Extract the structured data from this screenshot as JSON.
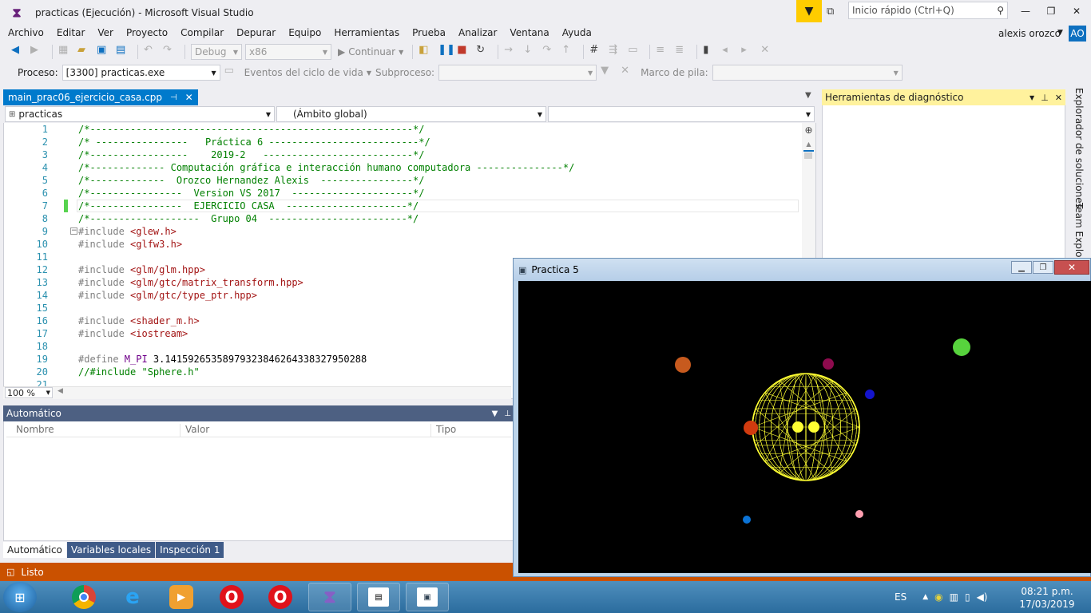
{
  "window": {
    "title": "practicas (Ejecución) - Microsoft Visual Studio",
    "quick_launch_placeholder": "Inicio rápido (Ctrl+Q)",
    "controls": {
      "minimize": "—",
      "maximize": "❐",
      "close": "✕"
    }
  },
  "menu": [
    "Archivo",
    "Editar",
    "Ver",
    "Proyecto",
    "Compilar",
    "Depurar",
    "Equipo",
    "Herramientas",
    "Prueba",
    "Analizar",
    "Ventana",
    "Ayuda"
  ],
  "user": {
    "name": "alexis orozco",
    "initials": "AO",
    "avatar_color": "#0e70c0"
  },
  "toolbar": {
    "config": "Debug",
    "platform": "x86",
    "continue_label": "Continuar"
  },
  "debug_bar": {
    "process_label": "Proceso:",
    "process_value": "[3300] practicas.exe",
    "lifecycle_label": "Eventos del ciclo de vida",
    "thread_label": "Subproceso:",
    "stack_label": "Marco de pila:"
  },
  "editor": {
    "tab_name": "main_prac06_ejercicio_casa.cpp",
    "scope_project": "practicas",
    "scope_global": "(Ámbito global)",
    "zoom": "100 %",
    "lines": [
      {
        "n": "1",
        "parts": [
          {
            "c": "cm",
            "t": "/*--------------------------------------------------------*/"
          }
        ]
      },
      {
        "n": "2",
        "parts": [
          {
            "c": "cm",
            "t": "/* ----------------   Práctica 6 --------------------------*/"
          }
        ]
      },
      {
        "n": "3",
        "parts": [
          {
            "c": "cm",
            "t": "/*-----------------    2019-2   --------------------------*/"
          }
        ]
      },
      {
        "n": "4",
        "parts": [
          {
            "c": "cm",
            "t": "/*------------- Computación gráfica e interacción humano computadora ---------------*/"
          }
        ]
      },
      {
        "n": "5",
        "parts": [
          {
            "c": "cm",
            "t": "/*-------------  Orozco Hernandez Alexis  ----------------*/"
          }
        ]
      },
      {
        "n": "6",
        "parts": [
          {
            "c": "cm",
            "t": "/*----------------  Version VS 2017  ---------------------*/"
          }
        ]
      },
      {
        "n": "7",
        "parts": [
          {
            "c": "cm",
            "t": "/*----------------  EJERCICIO CASA  ---------------------*/"
          }
        ]
      },
      {
        "n": "8",
        "parts": [
          {
            "c": "cm",
            "t": "/*-------------------  Grupo 04  ------------------------*/"
          }
        ]
      },
      {
        "n": "9",
        "parts": [
          {
            "c": "kw",
            "t": "#include "
          },
          {
            "c": "str",
            "t": "<glew.h>"
          }
        ]
      },
      {
        "n": "10",
        "parts": [
          {
            "c": "kw",
            "t": "#include "
          },
          {
            "c": "str",
            "t": "<glfw3.h>"
          }
        ]
      },
      {
        "n": "11",
        "parts": []
      },
      {
        "n": "12",
        "parts": [
          {
            "c": "kw",
            "t": "#include "
          },
          {
            "c": "str",
            "t": "<glm/glm.hpp>"
          }
        ]
      },
      {
        "n": "13",
        "parts": [
          {
            "c": "kw",
            "t": "#include "
          },
          {
            "c": "str",
            "t": "<glm/gtc/matrix_transform.hpp>"
          }
        ]
      },
      {
        "n": "14",
        "parts": [
          {
            "c": "kw",
            "t": "#include "
          },
          {
            "c": "str",
            "t": "<glm/gtc/type_ptr.hpp>"
          }
        ]
      },
      {
        "n": "15",
        "parts": []
      },
      {
        "n": "16",
        "parts": [
          {
            "c": "kw",
            "t": "#include "
          },
          {
            "c": "str",
            "t": "<shader_m.h>"
          }
        ]
      },
      {
        "n": "17",
        "parts": [
          {
            "c": "kw",
            "t": "#include "
          },
          {
            "c": "str",
            "t": "<iostream>"
          }
        ]
      },
      {
        "n": "18",
        "parts": []
      },
      {
        "n": "19",
        "parts": [
          {
            "c": "kw",
            "t": "#define "
          },
          {
            "c": "mac",
            "t": "M_PI"
          },
          {
            "c": "tx",
            "t": " 3.14159265358979323846264338327950288"
          }
        ]
      },
      {
        "n": "20",
        "parts": [
          {
            "c": "cm",
            "t": "//#include \"Sphere.h\""
          }
        ]
      },
      {
        "n": "21",
        "parts": []
      }
    ]
  },
  "diagnostics": {
    "title": "Herramientas de diagnóstico"
  },
  "side_tabs": [
    "Explorador de soluciones",
    "Team Explorer"
  ],
  "autos": {
    "title": "Automático",
    "columns": [
      "Nombre",
      "Valor",
      "Tipo"
    ],
    "tabs": [
      "Automático",
      "Variables locales",
      "Inspección 1"
    ]
  },
  "status": {
    "text": "Listo",
    "color": "#ca5100"
  },
  "gl_window": {
    "title": "Practica 5",
    "sun_color": "#ffff33",
    "planets": [
      {
        "color": "#c75a1e"
      },
      {
        "color": "#8e0b4e"
      },
      {
        "color": "#57d33d"
      },
      {
        "color": "#1414cc"
      },
      {
        "color": "#d13b0f"
      },
      {
        "color": "#0b73d6"
      },
      {
        "color": "#ff9fb0"
      }
    ]
  },
  "taskbar": {
    "lang": "ES",
    "time": "08:21 p.m.",
    "date": "17/03/2019"
  }
}
